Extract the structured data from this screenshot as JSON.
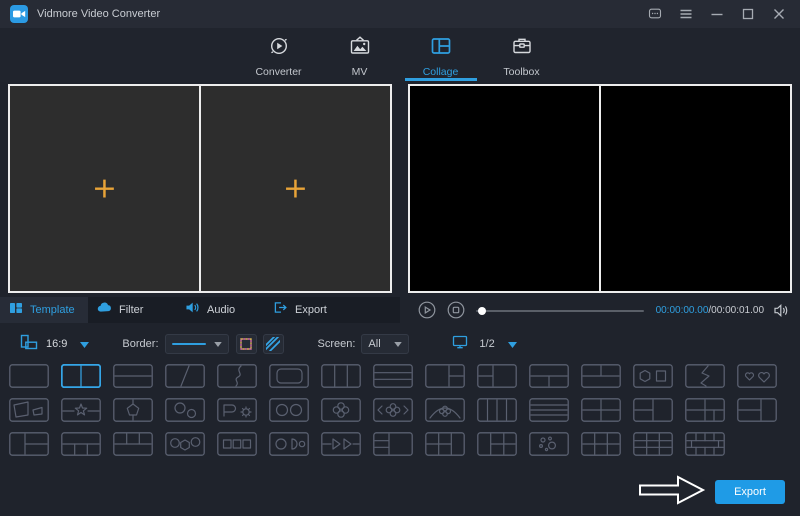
{
  "window": {
    "title": "Vidmore Video Converter"
  },
  "titlebar": {
    "buttons": [
      {
        "name": "feedback"
      },
      {
        "name": "menu"
      },
      {
        "name": "minimize"
      },
      {
        "name": "maximize"
      },
      {
        "name": "close"
      }
    ]
  },
  "nav": {
    "tabs": [
      {
        "label": "Converter",
        "icon": "converter-icon",
        "active": false
      },
      {
        "label": "MV",
        "icon": "mv-icon",
        "active": false
      },
      {
        "label": "Collage",
        "icon": "collage-icon",
        "active": true
      },
      {
        "label": "Toolbox",
        "icon": "toolbox-icon",
        "active": false
      }
    ]
  },
  "editor": {
    "cells": [
      {
        "add_symbol": "+"
      },
      {
        "add_symbol": "+"
      }
    ]
  },
  "panel_tabs": [
    {
      "label": "Template",
      "icon": "template-icon",
      "active": true
    },
    {
      "label": "Filter",
      "icon": "filter-icon",
      "active": false
    },
    {
      "label": "Audio",
      "icon": "audio-icon",
      "active": false
    },
    {
      "label": "Export",
      "icon": "export-icon",
      "active": false
    }
  ],
  "playback": {
    "current_time": "00:00:00.00",
    "time_separator": "/",
    "total_time": "00:00:01.00",
    "progress_percent": 0
  },
  "toolbar": {
    "aspect_ratio": "16:9",
    "border_label": "Border:",
    "screen_label": "Screen:",
    "screen_value": "All",
    "page_indicator": "1/2"
  },
  "templates": {
    "selected": {
      "row": 0,
      "col": 1
    },
    "rows": [
      [
        "single",
        "two-vertical",
        "two-horizontal",
        "diagonal",
        "curve-split",
        "rounded-inset",
        "three-vertical",
        "three-horizontal",
        "left-big-right-two",
        "left-two-right-big",
        "top-big-bottom-two",
        "top-two-bottom-big",
        "hexagon-square",
        "lightning-split",
        "two-hearts"
      ],
      [
        "skewed-quads",
        "star-band",
        "pentagon",
        "two-circles-diagonal",
        "flag-gear",
        "two-circles",
        "clover",
        "clover-brackets",
        "arc-flower",
        "four-vertical",
        "four-horizontal",
        "grid-2x2",
        "split-left-half",
        "grid-bottom-right",
        "wide-left-split"
      ],
      [
        "left-tall-right-rows",
        "top-one-bottom-three",
        "top-three-bottom-one",
        "circle-hex-circle",
        "three-squares",
        "circle-d-dot",
        "play-arrows",
        "left-rows-right-tall",
        "grid-2x2-right-col",
        "left-col-grid-2x2",
        "scatter-dots",
        "grid-3x2",
        "grid-3x3",
        "grid-complex"
      ]
    ]
  },
  "export_button": {
    "label": "Export"
  },
  "colors": {
    "accent": "#2f9fe0",
    "add_icon": "#e8a338",
    "selected_tile": "#35a6e8",
    "tile_stroke": "#5a6070",
    "export_bg": "#1f9be6"
  }
}
